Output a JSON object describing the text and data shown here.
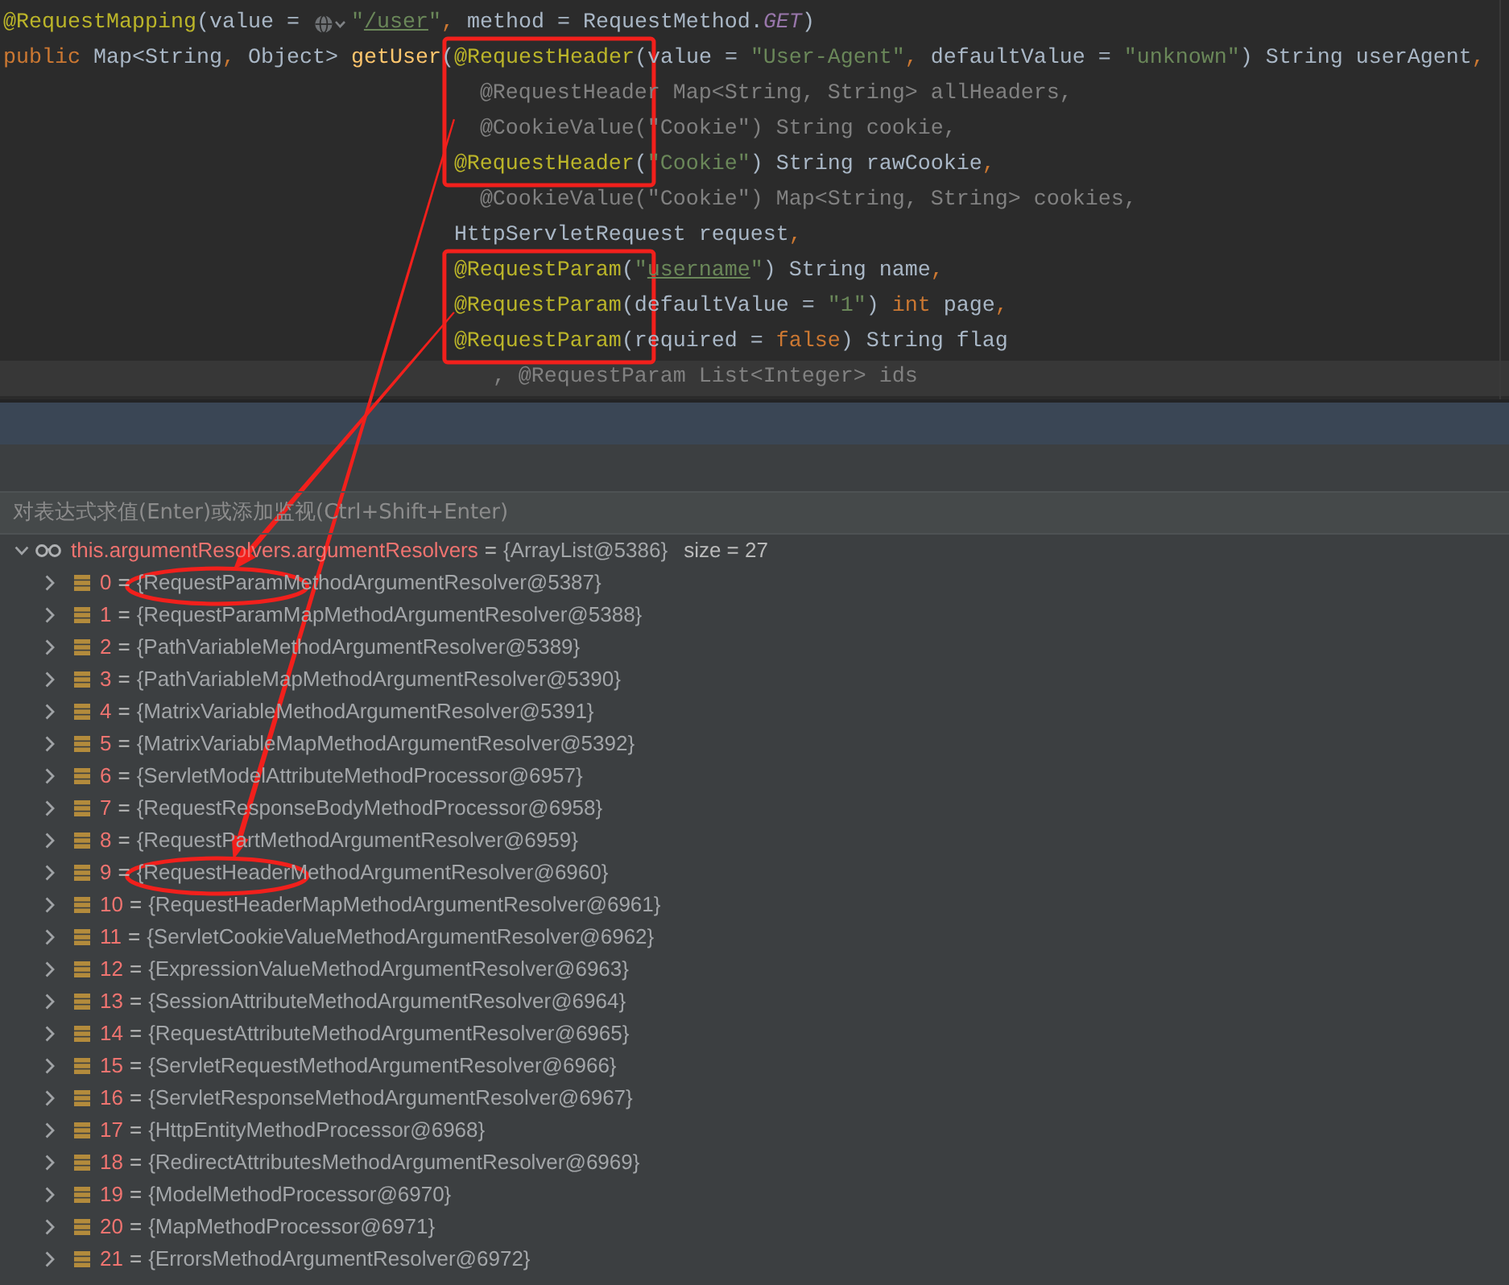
{
  "editor": {
    "lines": [
      {
        "boxed": false,
        "current": false,
        "tokens": [
          {
            "text": "@RequestMapping",
            "kind": "annotation"
          },
          {
            "text": "(value = ",
            "kind": "plain"
          },
          {
            "kind": "inlay"
          },
          {
            "text": "\"",
            "kind": "string"
          },
          {
            "text": "/user",
            "kind": "link"
          },
          {
            "text": "\"",
            "kind": "string"
          },
          {
            "text": ",",
            "kind": "keyword"
          },
          {
            "text": " method = RequestMethod.",
            "kind": "plain"
          },
          {
            "text": "GET",
            "kind": "constant"
          },
          {
            "text": ")",
            "kind": "plain"
          }
        ]
      },
      {
        "boxed": true,
        "current": false,
        "tokens": [
          {
            "text": "public",
            "kind": "keyword"
          },
          {
            "text": " Map<String",
            "kind": "plain"
          },
          {
            "text": ",",
            "kind": "keyword"
          },
          {
            "text": " Object> ",
            "kind": "plain"
          },
          {
            "text": "getUser",
            "kind": "method"
          },
          {
            "text": "(",
            "kind": "plain"
          },
          {
            "text": "@RequestHeader",
            "kind": "annotation"
          },
          {
            "text": "(value = ",
            "kind": "plain"
          },
          {
            "text": "\"User-Agent\"",
            "kind": "string"
          },
          {
            "text": ",",
            "kind": "keyword"
          },
          {
            "text": " defaultValue = ",
            "kind": "plain"
          },
          {
            "text": "\"unknown\"",
            "kind": "string"
          },
          {
            "text": ") String userAgent",
            "kind": "plain"
          },
          {
            "text": ",",
            "kind": "keyword"
          }
        ]
      },
      {
        "boxed": true,
        "current": false,
        "tokens": [
          {
            "text": "                                     @RequestHeader Map<String, String> allHeaders,",
            "kind": "unused"
          }
        ]
      },
      {
        "boxed": true,
        "current": false,
        "tokens": [
          {
            "text": "                                     @CookieValue(\"Cookie\") String cookie,",
            "kind": "unused"
          }
        ]
      },
      {
        "boxed": true,
        "current": false,
        "tokens": [
          {
            "text": "                                   @RequestHeader",
            "kind": "annotation"
          },
          {
            "text": "(",
            "kind": "plain"
          },
          {
            "text": "\"Cookie\"",
            "kind": "string"
          },
          {
            "text": ") String rawCookie",
            "kind": "plain"
          },
          {
            "text": ",",
            "kind": "keyword"
          }
        ]
      },
      {
        "boxed": false,
        "current": false,
        "tokens": [
          {
            "text": "                                     @CookieValue(\"Cookie\") Map<String, String> cookies,",
            "kind": "unused"
          }
        ]
      },
      {
        "boxed": false,
        "current": false,
        "tokens": [
          {
            "text": "                                   HttpServletRequest request",
            "kind": "plain"
          },
          {
            "text": ",",
            "kind": "keyword"
          }
        ]
      },
      {
        "boxed": true,
        "current": false,
        "tokens": [
          {
            "text": "                                   @RequestParam",
            "kind": "annotation"
          },
          {
            "text": "(",
            "kind": "plain"
          },
          {
            "text": "\"",
            "kind": "string"
          },
          {
            "text": "username",
            "kind": "link"
          },
          {
            "text": "\"",
            "kind": "string"
          },
          {
            "text": ") String name",
            "kind": "plain"
          },
          {
            "text": ",",
            "kind": "keyword"
          }
        ]
      },
      {
        "boxed": true,
        "current": false,
        "tokens": [
          {
            "text": "                                   @RequestParam",
            "kind": "annotation"
          },
          {
            "text": "(defaultValue = ",
            "kind": "plain"
          },
          {
            "text": "\"1\"",
            "kind": "string"
          },
          {
            "text": ") ",
            "kind": "plain"
          },
          {
            "text": "int",
            "kind": "keyword"
          },
          {
            "text": " page",
            "kind": "plain"
          },
          {
            "text": ",",
            "kind": "keyword"
          }
        ]
      },
      {
        "boxed": true,
        "current": false,
        "tokens": [
          {
            "text": "                                   @RequestParam",
            "kind": "annotation"
          },
          {
            "text": "(required = ",
            "kind": "plain"
          },
          {
            "text": "false",
            "kind": "keyword"
          },
          {
            "text": ") String flag",
            "kind": "plain"
          }
        ]
      },
      {
        "boxed": false,
        "current": true,
        "tokens": [
          {
            "text": "                                      , @RequestParam List<Integer> ids",
            "kind": "unused"
          }
        ]
      }
    ]
  },
  "debugger": {
    "evaluate_field": {
      "placeholder": "对表达式求值(Enter)或添加监视(Ctrl+Shift+Enter)"
    },
    "watch": {
      "name": "this.argumentResolvers.argumentResolvers",
      "separator": "=",
      "value": "{ArrayList@5386}",
      "size": "size = 27",
      "expanded": true,
      "children": [
        {
          "name": "0",
          "separator": "=",
          "value": "{RequestParamMethodArgumentResolver@5387}",
          "expanded": false,
          "circled": true
        },
        {
          "name": "1",
          "separator": "=",
          "value": "{RequestParamMapMethodArgumentResolver@5388}",
          "expanded": false,
          "circled": false
        },
        {
          "name": "2",
          "separator": "=",
          "value": "{PathVariableMethodArgumentResolver@5389}",
          "expanded": false,
          "circled": false
        },
        {
          "name": "3",
          "separator": "=",
          "value": "{PathVariableMapMethodArgumentResolver@5390}",
          "expanded": false,
          "circled": false
        },
        {
          "name": "4",
          "separator": "=",
          "value": "{MatrixVariableMethodArgumentResolver@5391}",
          "expanded": false,
          "circled": false
        },
        {
          "name": "5",
          "separator": "=",
          "value": "{MatrixVariableMapMethodArgumentResolver@5392}",
          "expanded": false,
          "circled": false
        },
        {
          "name": "6",
          "separator": "=",
          "value": "{ServletModelAttributeMethodProcessor@6957}",
          "expanded": false,
          "circled": false
        },
        {
          "name": "7",
          "separator": "=",
          "value": "{RequestResponseBodyMethodProcessor@6958}",
          "expanded": false,
          "circled": false
        },
        {
          "name": "8",
          "separator": "=",
          "value": "{RequestPartMethodArgumentResolver@6959}",
          "expanded": false,
          "circled": false
        },
        {
          "name": "9",
          "separator": "=",
          "value": "{RequestHeaderMethodArgumentResolver@6960}",
          "expanded": false,
          "circled": true
        },
        {
          "name": "10",
          "separator": "=",
          "value": "{RequestHeaderMapMethodArgumentResolver@6961}",
          "expanded": false,
          "circled": false
        },
        {
          "name": "11",
          "separator": "=",
          "value": "{ServletCookieValueMethodArgumentResolver@6962}",
          "expanded": false,
          "circled": false
        },
        {
          "name": "12",
          "separator": "=",
          "value": "{ExpressionValueMethodArgumentResolver@6963}",
          "expanded": false,
          "circled": false
        },
        {
          "name": "13",
          "separator": "=",
          "value": "{SessionAttributeMethodArgumentResolver@6964}",
          "expanded": false,
          "circled": false
        },
        {
          "name": "14",
          "separator": "=",
          "value": "{RequestAttributeMethodArgumentResolver@6965}",
          "expanded": false,
          "circled": false
        },
        {
          "name": "15",
          "separator": "=",
          "value": "{ServletRequestMethodArgumentResolver@6966}",
          "expanded": false,
          "circled": false
        },
        {
          "name": "16",
          "separator": "=",
          "value": "{ServletResponseMethodArgumentResolver@6967}",
          "expanded": false,
          "circled": false
        },
        {
          "name": "17",
          "separator": "=",
          "value": "{HttpEntityMethodProcessor@6968}",
          "expanded": false,
          "circled": false
        },
        {
          "name": "18",
          "separator": "=",
          "value": "{RedirectAttributesMethodArgumentResolver@6969}",
          "expanded": false,
          "circled": false
        },
        {
          "name": "19",
          "separator": "=",
          "value": "{ModelMethodProcessor@6970}",
          "expanded": false,
          "circled": false
        },
        {
          "name": "20",
          "separator": "=",
          "value": "{MapMethodProcessor@6971}",
          "expanded": false,
          "circled": false
        },
        {
          "name": "21",
          "separator": "=",
          "value": "{ErrorsMethodArgumentResolver@6972}",
          "expanded": false,
          "circled": false
        }
      ]
    }
  }
}
